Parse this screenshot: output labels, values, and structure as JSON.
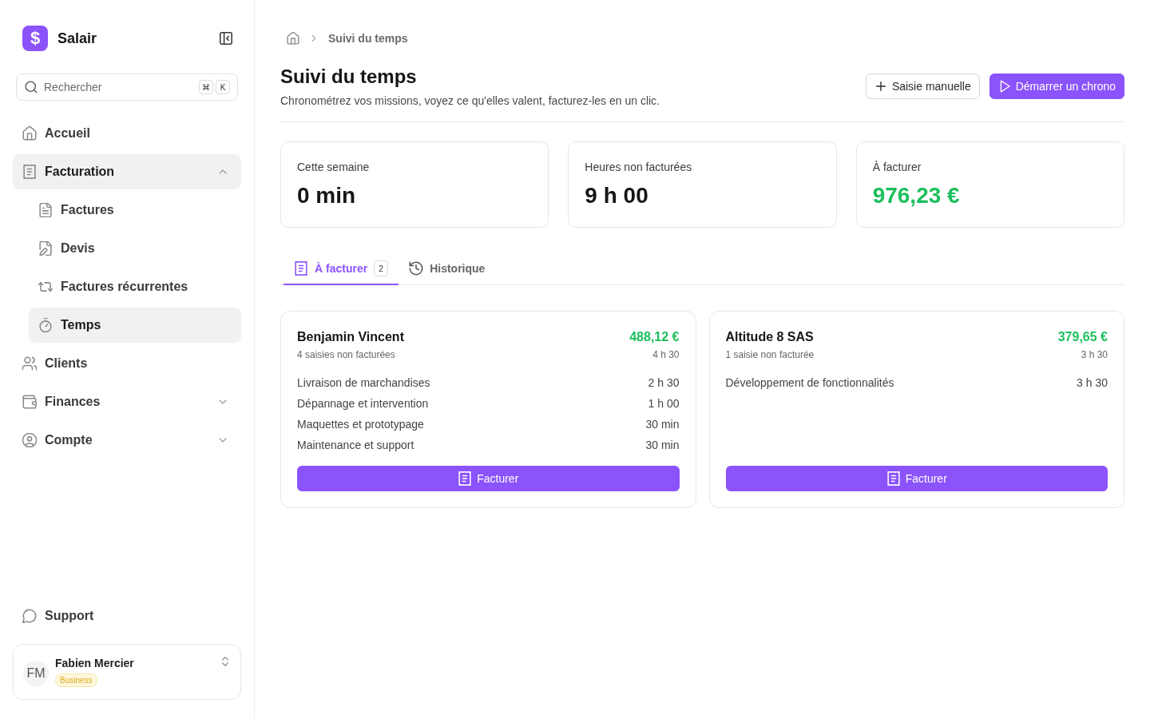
{
  "sidebar": {
    "brand": {
      "logo": "$",
      "name": "Salair"
    },
    "search": {
      "placeholder": "Rechercher",
      "shortcut": [
        "⌘",
        "K"
      ]
    },
    "nav": [
      {
        "label": "Accueil",
        "selected": false
      },
      {
        "label": "Facturation",
        "selected": true,
        "expanded": true,
        "children": [
          {
            "label": "Factures",
            "selected": false
          },
          {
            "label": "Devis",
            "selected": false
          },
          {
            "label": "Factures récurrentes",
            "selected": false
          },
          {
            "label": "Temps",
            "selected": true
          }
        ]
      },
      {
        "label": "Clients",
        "selected": false
      },
      {
        "label": "Finances",
        "selected": false,
        "expanded": false
      },
      {
        "label": "Compte",
        "selected": false,
        "expanded": false
      }
    ],
    "support": {
      "label": "Support"
    },
    "user": {
      "initials": "FM",
      "name": "Fabien Mercier",
      "plan": "Business"
    }
  },
  "breadcrumb": [
    "Suivi du temps"
  ],
  "header": {
    "title": "Suivi du temps",
    "subtitle": "Chronométrez vos missions, voyez ce qu'elles valent, facturez-les en un clic.",
    "actions": [
      {
        "label": "Saisie manuelle",
        "kind": "secondary"
      },
      {
        "label": "Démarrer un chrono",
        "kind": "primary"
      }
    ]
  },
  "stats": [
    {
      "label": "Cette semaine",
      "value": "0 min",
      "kind": "duration"
    },
    {
      "label": "Heures non facturées",
      "value": "9 h 00",
      "kind": "duration"
    },
    {
      "label": "À facturer",
      "value": "976,23 €",
      "kind": "amount"
    }
  ],
  "tabs": [
    {
      "label": "À facturer",
      "count": "2",
      "selected": true
    },
    {
      "label": "Historique",
      "selected": false
    }
  ],
  "clients": [
    {
      "name": "Benjamin Vincent",
      "amount": "488,12 €",
      "summary": "4 saisies non facturées",
      "total": "4 h 30",
      "entries": [
        {
          "label": "Livraison de marchandises",
          "duration": "2 h 30"
        },
        {
          "label": "Dépannage et intervention",
          "duration": "1 h 00"
        },
        {
          "label": "Maquettes et prototypage",
          "duration": "30 min"
        },
        {
          "label": "Maintenance et support",
          "duration": "30 min"
        }
      ],
      "action": "Facturer"
    },
    {
      "name": "Altitude 8 SAS",
      "amount": "379,65 €",
      "summary": "1 saisie non facturée",
      "total": "3 h 30",
      "entries": [
        {
          "label": "Développement de fonctionnalités",
          "duration": "3 h 30"
        }
      ],
      "action": "Facturer"
    }
  ]
}
